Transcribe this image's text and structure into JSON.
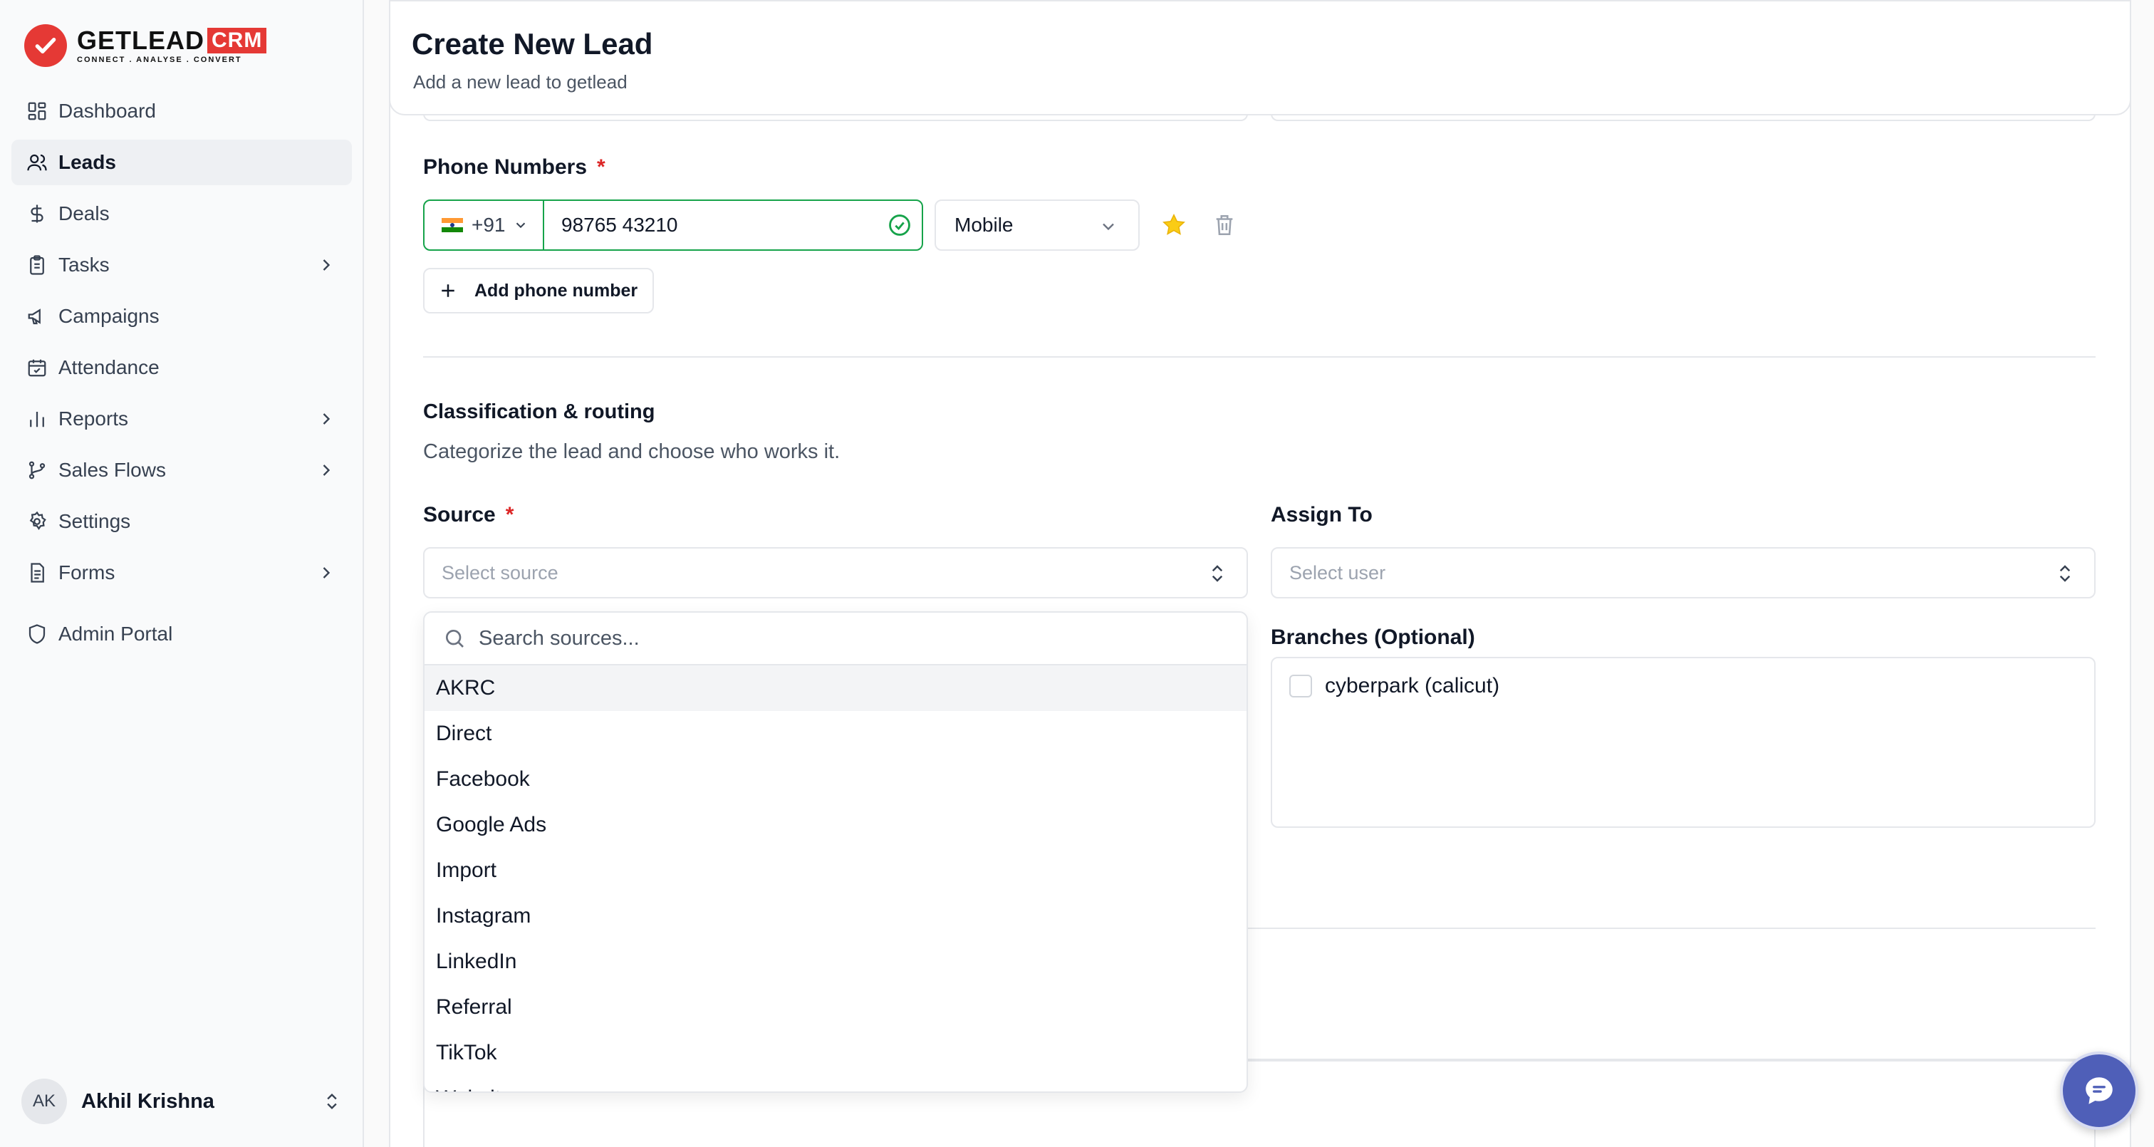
{
  "brand": {
    "name": "GETLEAD",
    "crm": "CRM",
    "tagline": "CONNECT . ANALYSE . CONVERT",
    "accent": "#e53935"
  },
  "sidebar": {
    "items": [
      {
        "label": "Dashboard",
        "icon": "dashboard-icon"
      },
      {
        "label": "Leads",
        "icon": "users-icon",
        "active": true
      },
      {
        "label": "Deals",
        "icon": "dollar-icon"
      },
      {
        "label": "Tasks",
        "icon": "clipboard-icon",
        "expandable": true
      },
      {
        "label": "Campaigns",
        "icon": "megaphone-icon"
      },
      {
        "label": "Attendance",
        "icon": "calendar-check-icon"
      },
      {
        "label": "Reports",
        "icon": "bar-chart-icon",
        "expandable": true
      },
      {
        "label": "Sales Flows",
        "icon": "git-branch-icon",
        "expandable": true
      },
      {
        "label": "Settings",
        "icon": "gear-icon"
      },
      {
        "label": "Forms",
        "icon": "file-text-icon",
        "expandable": true
      },
      {
        "label": "Admin Portal",
        "icon": "shield-icon"
      }
    ],
    "user": {
      "initials": "AK",
      "name": "Akhil Krishna"
    }
  },
  "header": {
    "title": "Create New Lead",
    "subtitle": "Add a new lead to getlead"
  },
  "phone": {
    "label": "Phone Numbers",
    "required_mark": "*",
    "country_code": "+91",
    "number": "98765 43210",
    "type": "Mobile",
    "add_label": "Add phone number",
    "valid_color": "#16a34a",
    "star_color": "#facc15"
  },
  "classification": {
    "title": "Classification & routing",
    "subtitle": "Categorize the lead and choose who works it.",
    "source": {
      "label": "Source",
      "required_mark": "*",
      "placeholder": "Select source"
    },
    "assign": {
      "label": "Assign To",
      "placeholder": "Select user"
    },
    "branches": {
      "label": "Branches (Optional)",
      "options": [
        "cyberpark (calicut)"
      ]
    }
  },
  "source_dropdown": {
    "search_placeholder": "Search sources...",
    "options": [
      "AKRC",
      "Direct",
      "Facebook",
      "Google Ads",
      "Import",
      "Instagram",
      "LinkedIn",
      "Referral",
      "TikTok",
      "Website"
    ],
    "highlighted": "AKRC"
  },
  "chat": {
    "icon": "chat-icon",
    "color": "#4f5fb8"
  }
}
